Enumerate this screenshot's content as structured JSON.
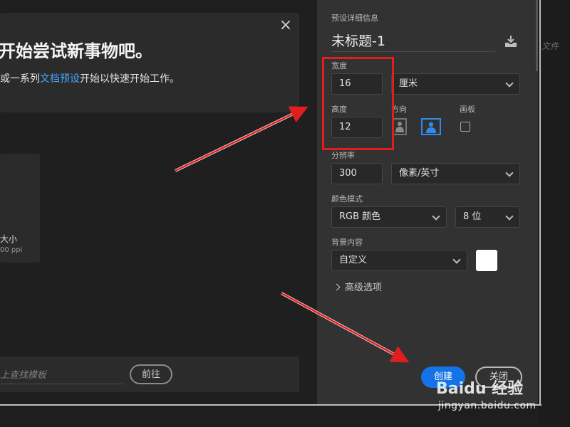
{
  "welcome": {
    "title": "开始尝试新事物吧。",
    "subtitle_before": "或一系列",
    "subtitle_link": "文档预设",
    "subtitle_after": "开始以快速开始工作。"
  },
  "preset": {
    "name": "大小",
    "meta": "00 ppi"
  },
  "template_search": {
    "placeholder": "上查找模板",
    "go_label": "前往"
  },
  "details": {
    "section_title": "预设详细信息",
    "doc_title": "未标题-1",
    "width_label": "宽度",
    "width_value": "16",
    "unit_value": "厘米",
    "height_label": "高度",
    "height_value": "12",
    "orientation_label": "方向",
    "artboard_label": "画板",
    "resolution_label": "分辨率",
    "resolution_value": "300",
    "resolution_unit": "像素/英寸",
    "color_mode_label": "颜色模式",
    "color_mode_value": "RGB 颜色",
    "bit_depth_value": "8 位",
    "background_label": "背景内容",
    "background_value": "自定义",
    "background_color": "#ffffff",
    "advanced_label": "高级选项",
    "create_label": "创建",
    "close_label": "关闭"
  },
  "right_strip": {
    "text": "文件"
  },
  "annotations": {
    "highlight_color": "#e01e1e"
  },
  "watermark": {
    "brand": "Baidu 经验",
    "url": "jingyan.baidu.com"
  },
  "colors": {
    "accent": "#1473e6",
    "link": "#4aa3ff",
    "panel_bg": "#323232"
  }
}
